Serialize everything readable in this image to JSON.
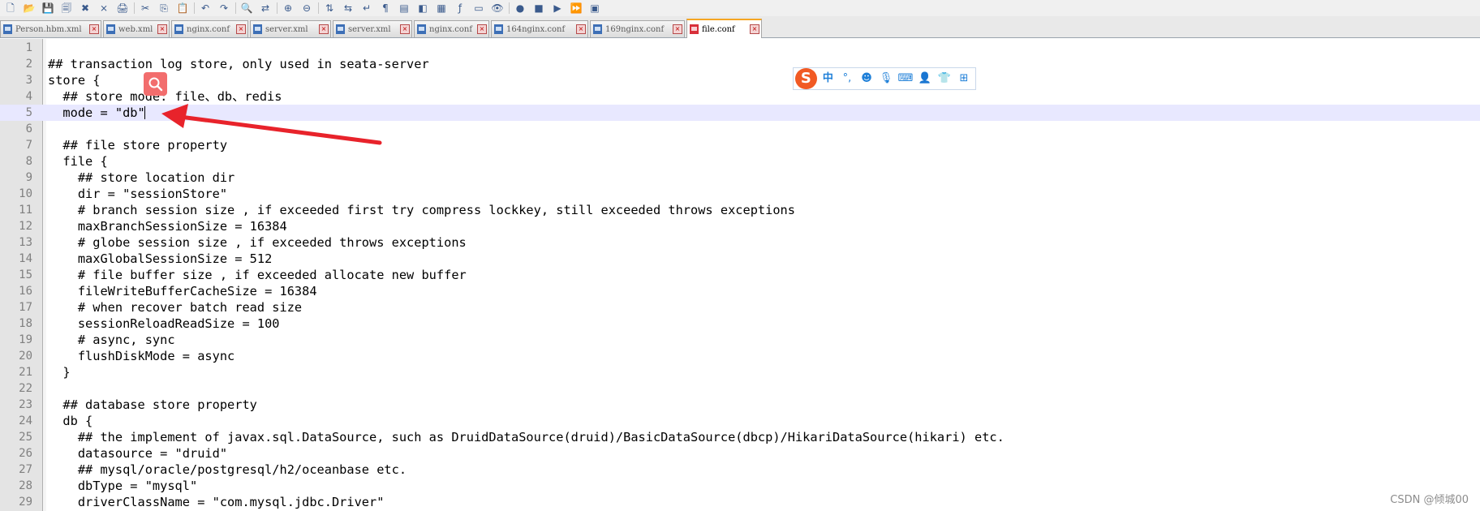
{
  "toolbar": {
    "icons": [
      "new-file-icon",
      "open-icon",
      "save-icon",
      "save-all-icon",
      "close-icon",
      "close-all-icon",
      "print-icon",
      "cut-icon",
      "copy-icon",
      "paste-icon",
      "undo-icon",
      "redo-icon",
      "find-icon",
      "replace-icon",
      "zoom-in-icon",
      "zoom-out-icon",
      "sync-v-icon",
      "sync-h-icon",
      "wrap-icon",
      "all-chars-icon",
      "indent-guide-icon",
      "lang-icon",
      "doc-map-icon",
      "func-list-icon",
      "folder-icon",
      "monitor-icon",
      "record-icon",
      "stop-icon",
      "play-icon",
      "play-multi-icon",
      "save-macro-icon"
    ],
    "glyphs": [
      "🗋",
      "📂",
      "💾",
      "🗐",
      "✖",
      "⨯",
      "🖨",
      "✂",
      "⎘",
      "📋",
      "↶",
      "↷",
      "🔍",
      "⇄",
      "⊕",
      "⊖",
      "⇅",
      "⇆",
      "↵",
      "¶",
      "▤",
      "◧",
      "▦",
      "ƒ",
      "▭",
      "👁",
      "●",
      "■",
      "▶",
      "⏩",
      "▣"
    ]
  },
  "tabs": [
    {
      "label": "Person.hbm.xml",
      "active": false
    },
    {
      "label": "web.xml",
      "active": false
    },
    {
      "label": "nginx.conf",
      "active": false
    },
    {
      "label": "server.xml",
      "active": false
    },
    {
      "label": "server.xml",
      "active": false
    },
    {
      "label": "nginx.conf",
      "active": false
    },
    {
      "label": "164nginx.conf",
      "active": false
    },
    {
      "label": "169nginx.conf",
      "active": false
    },
    {
      "label": "file.conf",
      "active": true
    }
  ],
  "editor": {
    "current_line": 5,
    "lines": [
      "",
      "## transaction log store, only used in seata-server",
      "store {",
      "  ## store mode: file、db、redis",
      "  mode = \"db\"",
      "",
      "  ## file store property",
      "  file {",
      "    ## store location dir",
      "    dir = \"sessionStore\"",
      "    # branch session size , if exceeded first try compress lockkey, still exceeded throws exceptions",
      "    maxBranchSessionSize = 16384",
      "    # globe session size , if exceeded throws exceptions",
      "    maxGlobalSessionSize = 512",
      "    # file buffer size , if exceeded allocate new buffer",
      "    fileWriteBufferCacheSize = 16384",
      "    # when recover batch read size",
      "    sessionReloadReadSize = 100",
      "    # async, sync",
      "    flushDiskMode = async",
      "  }",
      "",
      "  ## database store property",
      "  db {",
      "    ## the implement of javax.sql.DataSource, such as DruidDataSource(druid)/BasicDataSource(dbcp)/HikariDataSource(hikari) etc.",
      "    datasource = \"druid\"",
      "    ## mysql/oracle/postgresql/h2/oceanbase etc.",
      "    dbType = \"mysql\"",
      "    driverClassName = \"com.mysql.jdbc.Driver\""
    ]
  },
  "ime": {
    "logo": "S",
    "mode": "中",
    "items": [
      {
        "name": "punctuation-icon",
        "glyph": "°,"
      },
      {
        "name": "emoji-icon",
        "glyph": "☻"
      },
      {
        "name": "voice-icon",
        "glyph": "🎙"
      },
      {
        "name": "keyboard-icon",
        "glyph": "⌨"
      },
      {
        "name": "user-icon",
        "glyph": "👤"
      },
      {
        "name": "skin-icon",
        "glyph": "👕"
      },
      {
        "name": "toolbox-icon",
        "glyph": "⊞"
      }
    ]
  },
  "watermark": "CSDN @倾城00",
  "colors": {
    "annotation_arrow": "#e8232b",
    "search_bubble": "#f26d6d",
    "ime_accent": "#f15a24"
  }
}
